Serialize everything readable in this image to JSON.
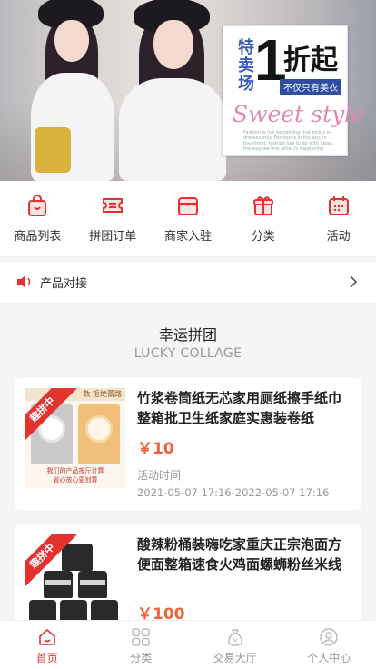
{
  "banner": {
    "promo_vertical": "特卖场",
    "promo_number": "1",
    "promo_zhe": "折起",
    "promo_tag": "不仅只有美衣",
    "promo_script": "Sweet style",
    "promo_small": "Fashion is not something that exists in dresses only. Fashion is in the sky, in the street, fashion has to do with ideas, the way we live, what is happening"
  },
  "quicknav": [
    {
      "label": "商品列表",
      "icon": "shopping-bag-icon"
    },
    {
      "label": "拼团订单",
      "icon": "ticket-icon"
    },
    {
      "label": "商家入驻",
      "icon": "store-icon"
    },
    {
      "label": "分类",
      "icon": "gift-box-icon"
    },
    {
      "label": "活动",
      "icon": "calendar-icon"
    }
  ],
  "notice": {
    "text": "产品对接"
  },
  "section": {
    "title": "幸运拼团",
    "subtitle": "LUCKY COLLAGE"
  },
  "products": [
    {
      "badge": "趣拼中",
      "title": "竹浆卷筒纸无芯家用厕纸擦手纸巾整箱批卫生纸家庭实惠装卷纸",
      "price": "￥10",
      "time_label": "活动时间",
      "time": "2021-05-07 17:16-2022-05-07 17:16",
      "thumb_top": "数  拒绝蕾路",
      "thumb_bottom": "我们的产品按斤计算",
      "thumb_bottom2": "省心放心更划算"
    },
    {
      "badge": "趣拼中",
      "title": "酸辣粉桶装嗨吃家重庆正宗泡面方便面整箱速食火鸡面螺蛳粉丝米线",
      "price": "￥100"
    }
  ],
  "tabbar": [
    {
      "label": "首页",
      "icon": "home-icon",
      "active": true
    },
    {
      "label": "分类",
      "icon": "grid-icon",
      "active": false
    },
    {
      "label": "交易大厅",
      "icon": "money-bag-icon",
      "active": false
    },
    {
      "label": "个人中心",
      "icon": "user-icon",
      "active": false
    }
  ],
  "colors": {
    "accent": "#e4322f",
    "price": "#f0633a"
  }
}
